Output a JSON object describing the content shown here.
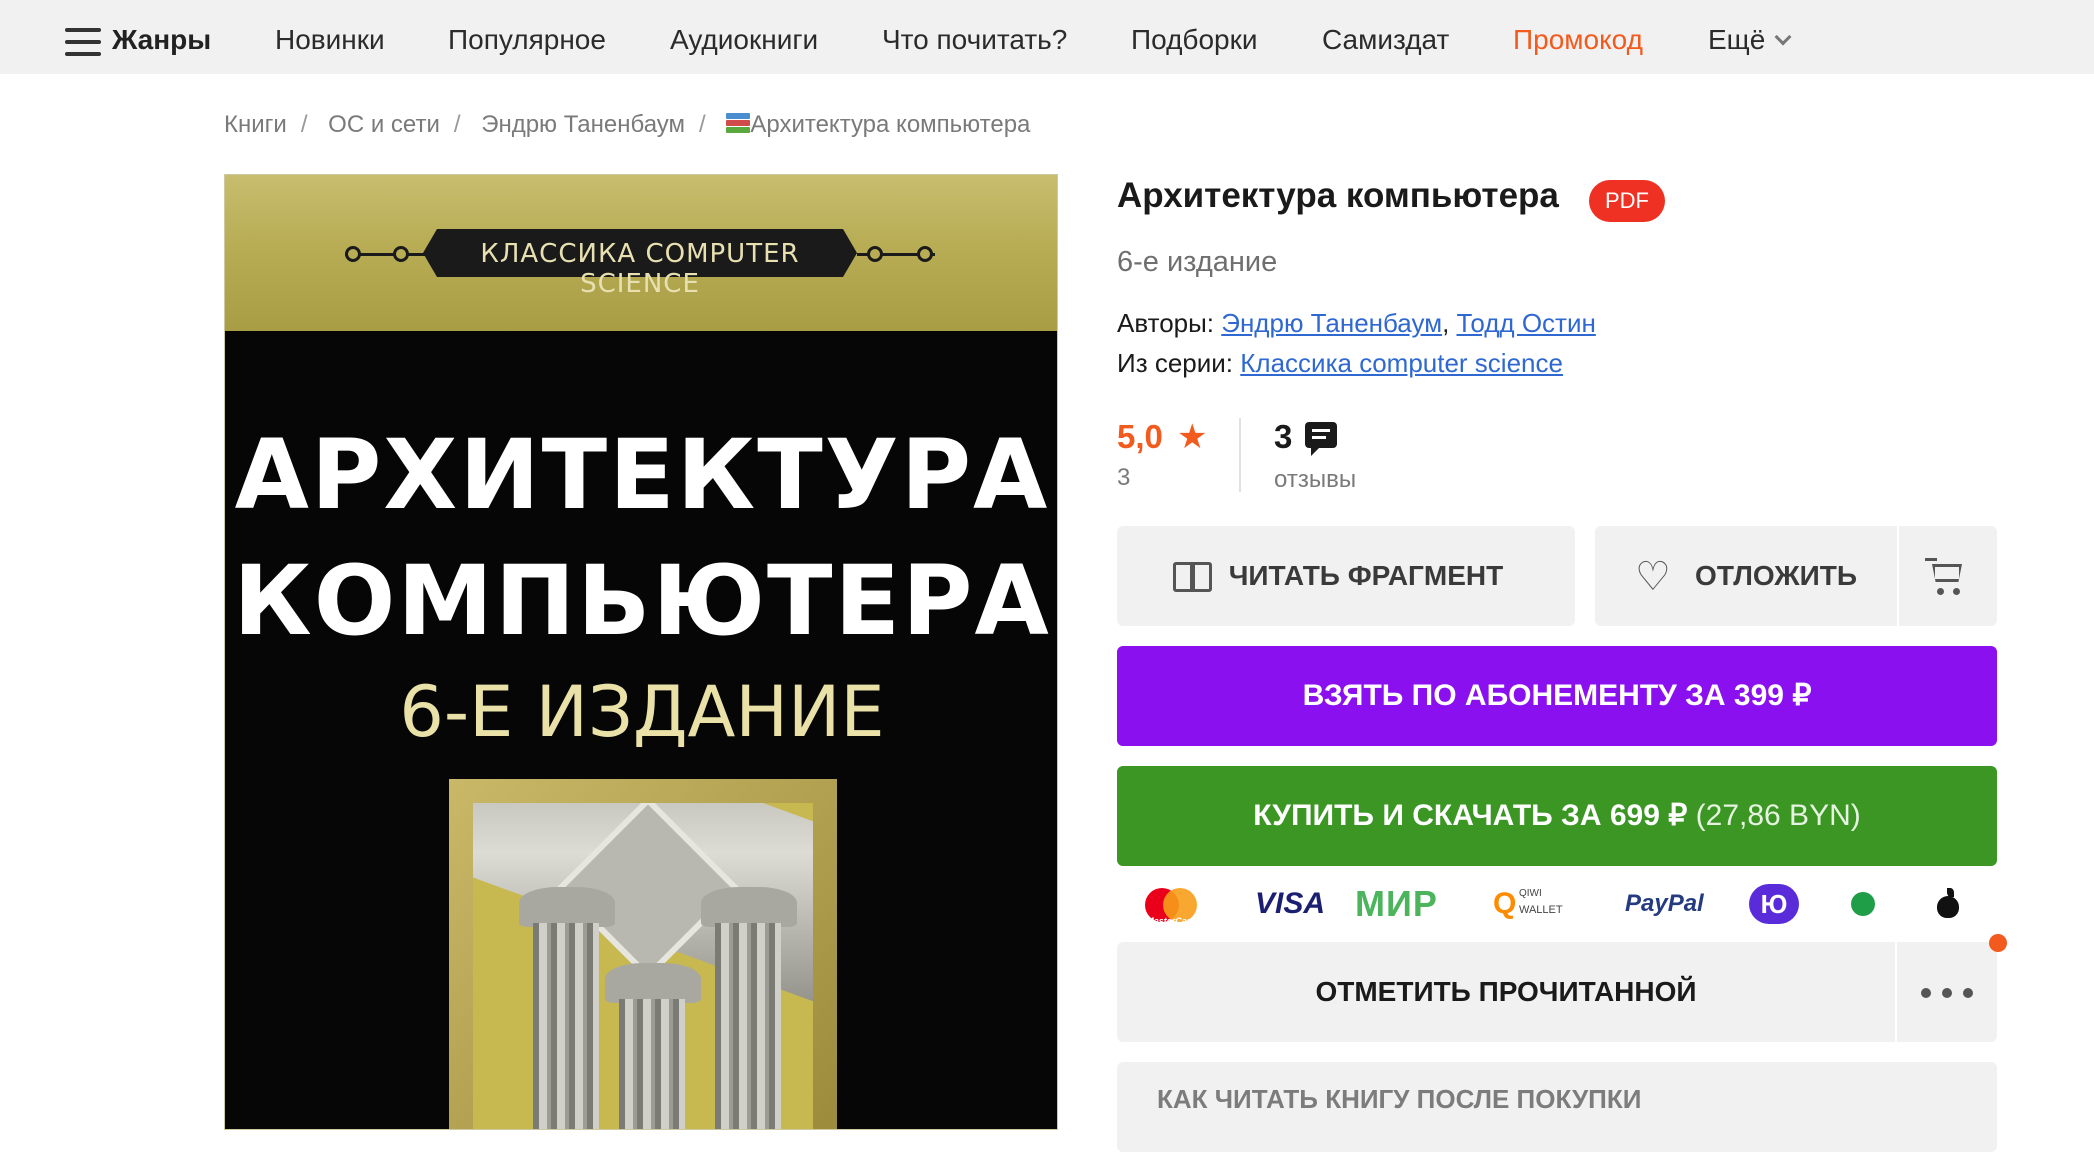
{
  "nav": {
    "genres": "Жанры",
    "items": [
      "Новинки",
      "Популярное",
      "Аудиокниги",
      "Что почитать?",
      "Подборки",
      "Самиздат",
      "Промокод",
      "Ещё"
    ]
  },
  "breadcrumb": {
    "items": [
      "Книги",
      "ОС и сети",
      "Эндрю Таненбаум",
      "Архитектура компьютера"
    ],
    "separator": "/"
  },
  "cover": {
    "series": "КЛАССИКА COMPUTER SCIENCE",
    "title_line1": "АРХИТЕКТУРА",
    "title_line2": "КОМПЬЮТЕРА",
    "edition": "6-Е ИЗДАНИЕ"
  },
  "book": {
    "title": "Архитектура компьютера",
    "format_badge": "PDF",
    "edition": "6-е издание",
    "authors_label": "Авторы:",
    "authors": [
      "Эндрю Таненбаум",
      "Тодд Остин"
    ],
    "series_label": "Из серии:",
    "series": "Классика computer science"
  },
  "rating": {
    "value": "5,0",
    "count": "3",
    "reviews_count": "3",
    "reviews_label": "отзывы"
  },
  "actions": {
    "read_fragment": "ЧИТАТЬ ФРАГМЕНТ",
    "defer": "ОТЛОЖИТЬ",
    "subscription": "ВЗЯТЬ ПО АБОНЕМЕНТУ ЗА 399 ₽",
    "buy": "КУПИТЬ И СКАЧАТЬ ЗА 699 ₽",
    "buy_alt_price": "(27,86 BYN)",
    "mark_read": "ОТМЕТИТЬ ПРОЧИТАННОЙ",
    "how_to_read": "КАК ЧИТАТЬ КНИГУ ПОСЛЕ ПОКУПКИ"
  },
  "payments": {
    "mastercard": "MasterCard",
    "visa": "VISA",
    "mir": "МИР",
    "qiwi_q": "Q",
    "qiwi_top": "QIWI",
    "qiwi_bottom": "WALLET",
    "paypal": "PayPal",
    "yoomoney": "Ю"
  },
  "colors": {
    "accent_orange": "#f25a1e",
    "subscription_purple": "#8b10f0",
    "buy_green": "#3b9624",
    "pdf_red": "#ef3124",
    "link_blue": "#2f68d0"
  },
  "icons": [
    "menu-icon",
    "chevron-down-icon",
    "books-icon",
    "star-icon",
    "comment-icon",
    "book-open-icon",
    "heart-icon",
    "cart-icon",
    "more-icon"
  ]
}
